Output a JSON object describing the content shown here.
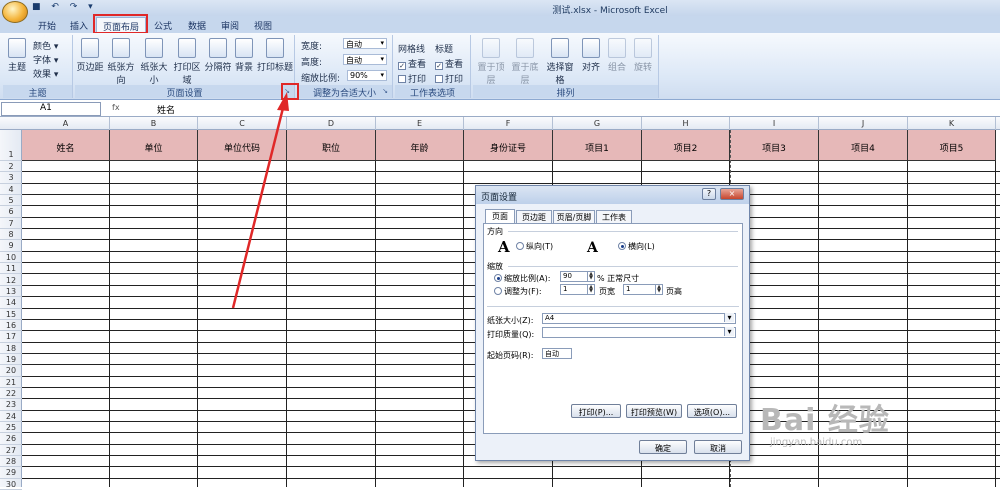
{
  "window": {
    "title": "测试.xlsx - Microsoft Excel",
    "qat": "■ ↶ ↷ ▾"
  },
  "tabs": [
    "开始",
    "插入",
    "页面布局",
    "公式",
    "数据",
    "审阅",
    "视图"
  ],
  "ribbon": {
    "theme": {
      "label": "主题",
      "buttons": [
        "主题"
      ],
      "small": [
        "颜色 ▾",
        "字体 ▾",
        "效果 ▾"
      ]
    },
    "page_setup": {
      "label": "页面设置",
      "buttons": [
        "页边距",
        "纸张方向",
        "纸张大小",
        "打印区域",
        "分隔符",
        "背景",
        "打印标题"
      ]
    },
    "fit": {
      "label": "调整为合适大小",
      "width_label": "宽度:",
      "width_value": "自动",
      "height_label": "高度:",
      "height_value": "自动",
      "scale_label": "缩放比例:",
      "scale_value": "90%"
    },
    "sheet_options": {
      "label": "工作表选项",
      "gridlines": "网格线",
      "headings": "标题",
      "view": "查看",
      "print": "打印"
    },
    "arrange": {
      "label": "排列",
      "buttons": [
        "置于顶层",
        "置于底层",
        "选择窗格",
        "对齐",
        "组合",
        "旋转"
      ]
    }
  },
  "formula_bar": {
    "cell_ref": "A1",
    "fx": "fx",
    "value": "姓名"
  },
  "sheet": {
    "columns": [
      "A",
      "B",
      "C",
      "D",
      "E",
      "F",
      "G",
      "H",
      "I",
      "J",
      "K"
    ],
    "header_row": [
      "姓名",
      "单位",
      "单位代码",
      "职位",
      "年龄",
      "身份证号",
      "项目1",
      "项目2",
      "项目3",
      "项目4",
      "项目5"
    ],
    "rows": [
      "1",
      "2",
      "3",
      "4",
      "5",
      "6",
      "7",
      "8",
      "9",
      "10",
      "11",
      "12",
      "13",
      "14",
      "15",
      "16",
      "17",
      "18",
      "19",
      "20",
      "21",
      "22",
      "23",
      "24",
      "25",
      "26",
      "27",
      "28",
      "29",
      "30"
    ],
    "header_fill": "#e6b8b8"
  },
  "dialog": {
    "title": "页面设置",
    "help": "?",
    "close": "×",
    "tabs": [
      "页面",
      "页边距",
      "页眉/页脚",
      "工作表"
    ],
    "orientation_label": "方向",
    "portrait": "纵向(T)",
    "landscape": "横向(L)",
    "scaling_label": "缩放",
    "adjust_to": "缩放比例(A):",
    "adjust_value": "90",
    "adjust_suffix": "% 正常尺寸",
    "fit_to": "调整为(F):",
    "fit_wide_value": "1",
    "fit_wide_label": "页宽",
    "fit_tall_value": "1",
    "fit_tall_label": "页高",
    "paper_size_label": "纸张大小(Z):",
    "paper_size_value": "A4",
    "print_quality_label": "打印质量(Q):",
    "print_quality_value": "",
    "first_page_label": "起始页码(R):",
    "first_page_value": "自动",
    "print_btn": "打印(P)...",
    "preview_btn": "打印预览(W)",
    "options_btn": "选项(O)...",
    "ok_btn": "确定",
    "cancel_btn": "取消"
  },
  "watermark": {
    "main": "Bai 经验",
    "sub": "jingyan.baidu.com"
  },
  "annotation_color": "#e02828"
}
